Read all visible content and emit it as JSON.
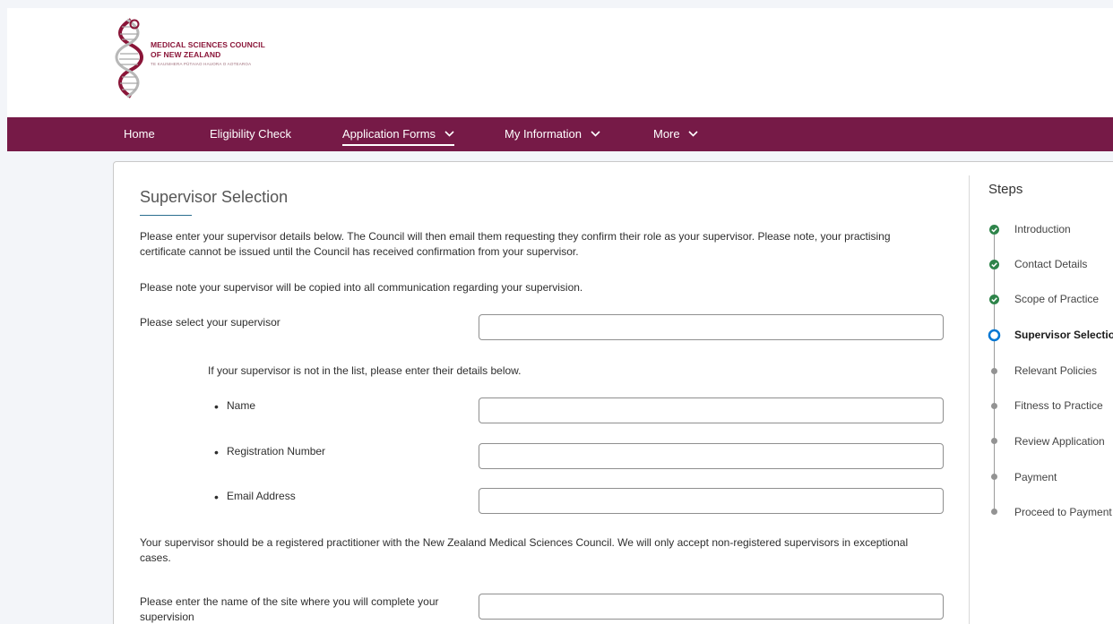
{
  "logo": {
    "line1": "MEDICAL SCIENCES COUNCIL",
    "line2": "OF NEW ZEALAND",
    "line3": "TE KAUNIHERA PŪTAIAO HAUORA O AOTEAROA"
  },
  "nav": {
    "items": [
      {
        "label": "Home"
      },
      {
        "label": "Eligibility Check"
      },
      {
        "label": "Application Forms",
        "dropdown": true,
        "active": true
      },
      {
        "label": "My Information",
        "dropdown": true
      },
      {
        "label": "More",
        "dropdown": true
      }
    ]
  },
  "form": {
    "title": "Supervisor Selection",
    "intro1": "Please enter your supervisor details below. The Council will then email them requesting they confirm their role as your supervisor. Please note, your practising certificate cannot be issued until the Council has received confirmation from your supervisor.",
    "intro2": "Please note your supervisor will be copied into all communication regarding your supervision.",
    "select_label": "Please select your supervisor",
    "select_value": "",
    "not_in_list": "If your supervisor is not in the list, please enter their details below.",
    "name_label": "Name",
    "name_value": "",
    "reg_label": "Registration Number",
    "reg_value": "",
    "email_label": "Email Address",
    "email_value": "",
    "note": "Your supervisor should be a registered practitioner with the New Zealand Medical Sciences Council. We will only accept non-registered supervisors in exceptional cases.",
    "site_label": "Please enter the name of the site where you will complete your supervision",
    "site_value": ""
  },
  "steps": {
    "title": "Steps",
    "items": [
      {
        "label": "Introduction",
        "status": "complete"
      },
      {
        "label": "Contact Details",
        "status": "complete"
      },
      {
        "label": "Scope of Practice",
        "status": "complete"
      },
      {
        "label": "Supervisor Selection",
        "status": "current"
      },
      {
        "label": "Relevant Policies",
        "status": "pending"
      },
      {
        "label": "Fitness to Practice",
        "status": "pending"
      },
      {
        "label": "Review Application",
        "status": "pending"
      },
      {
        "label": "Payment",
        "status": "pending"
      },
      {
        "label": "Proceed to Payment",
        "status": "pending"
      }
    ]
  },
  "colors": {
    "brand": "#761a47",
    "complete": "#2e844a",
    "current": "#0176d3",
    "pending": "#939393"
  }
}
